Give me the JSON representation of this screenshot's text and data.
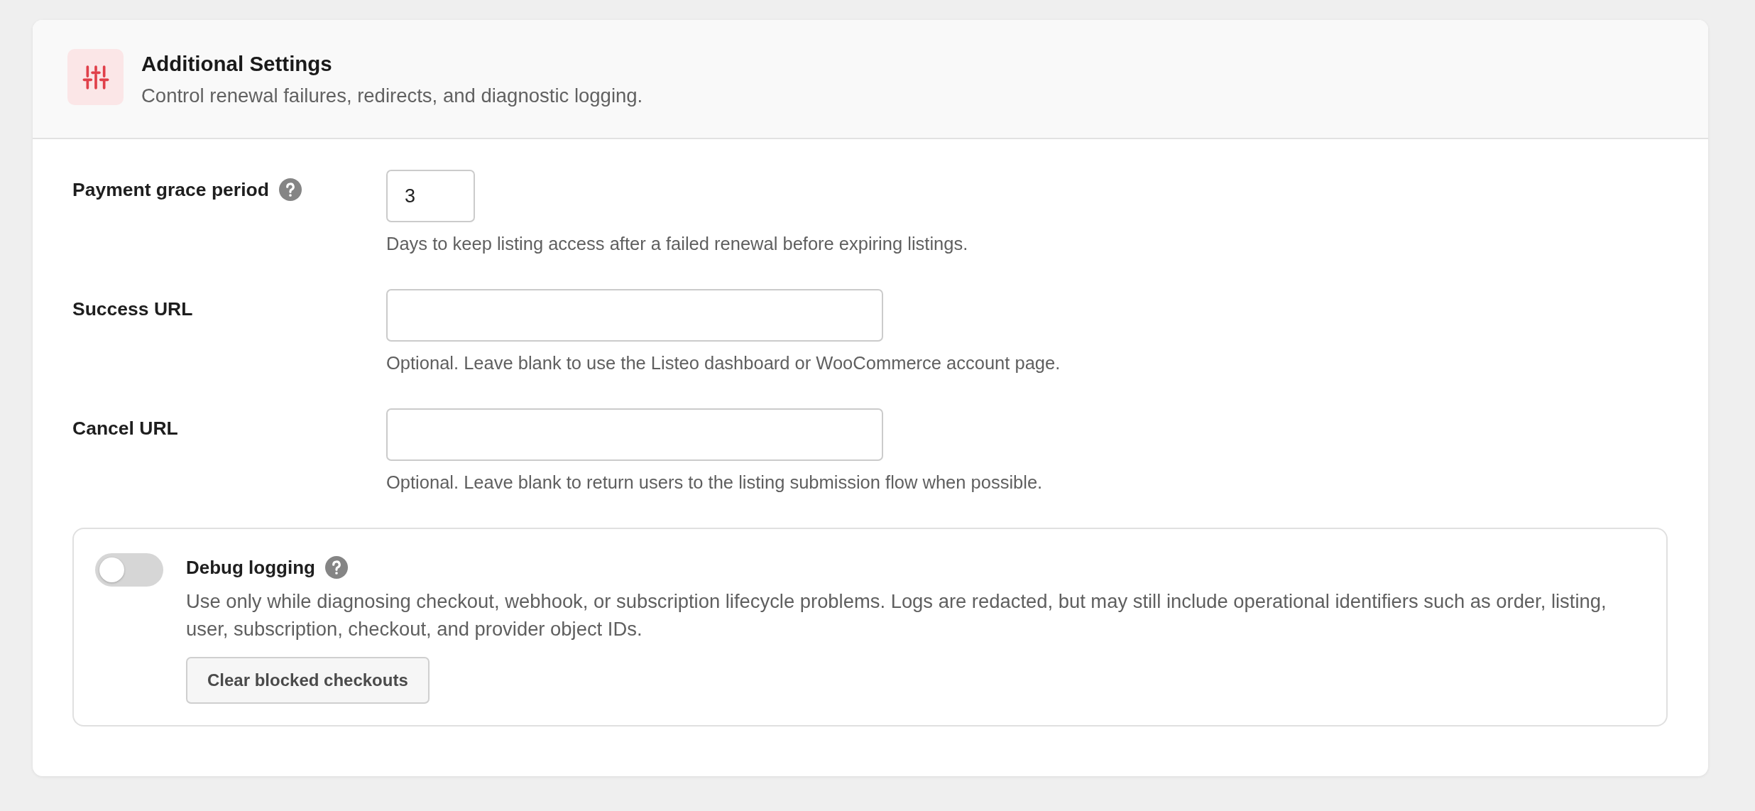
{
  "header": {
    "title": "Additional Settings",
    "subtitle": "Control renewal failures, redirects, and diagnostic logging."
  },
  "fields": [
    {
      "kind": "number",
      "label": "Payment grace period",
      "help": true,
      "value": "3",
      "hint": "Days to keep listing access after a failed renewal before expiring listings."
    },
    {
      "kind": "url",
      "label": "Success URL",
      "help": false,
      "hint": "Optional. Leave blank to use the Listeo dashboard or WooCommerce account page."
    },
    {
      "kind": "url",
      "label": "Cancel URL",
      "help": false,
      "hint": "Optional. Leave blank to return users to the listing submission flow when possible."
    }
  ],
  "debug": {
    "label": "Debug logging",
    "help": true,
    "on": false,
    "description": "Use only while diagnosing checkout, webhook, or subscription lifecycle problems. Logs are redacted, but may still include operational identifiers such as order, listing, user, subscription, checkout, and provider object IDs.",
    "button": "Clear blocked checkouts"
  }
}
